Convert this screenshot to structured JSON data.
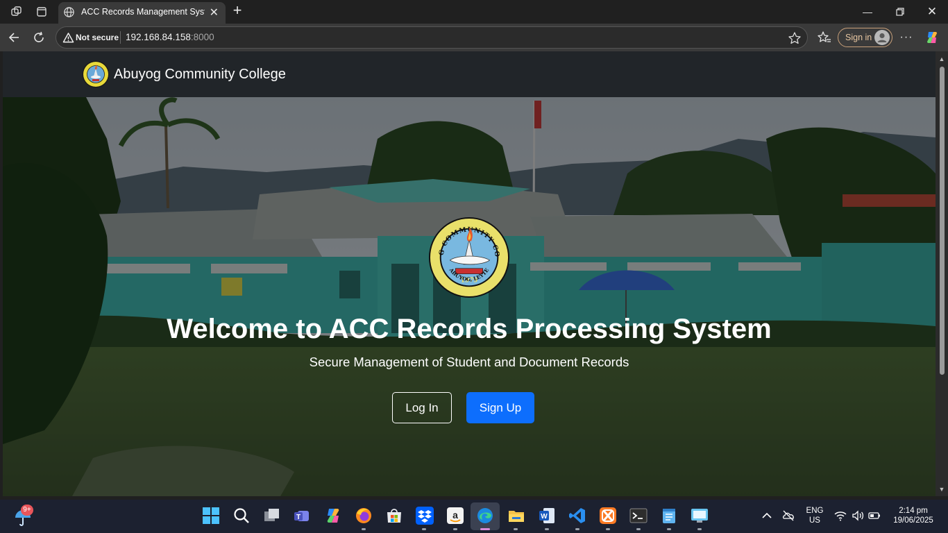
{
  "browser": {
    "tab_title": "ACC Records Management System",
    "address_security": "Not secure",
    "address_host": "192.168.84.158",
    "address_port": ":8000",
    "signin_label": "Sign in"
  },
  "site": {
    "brand_name": "Abuyog Community College",
    "hero_title": "Welcome to ACC Records Processing System",
    "hero_subtitle": "Secure Management of Student and Document Records",
    "login_label": "Log In",
    "signup_label": "Sign Up",
    "seal_text_top": "ABUYOG COMMUNITY COLLEGE",
    "seal_text_bottom": "ABUYOG, LEYTE",
    "seal_year": "1979"
  },
  "colors": {
    "navbar": "#212529",
    "primary_button": "#0d6efd",
    "browser_toolbar": "#3a3a3a",
    "taskbar": "#1c2130"
  },
  "taskbar": {
    "notification_badge": "9+",
    "language": "ENG",
    "region": "US",
    "time": "2:14 pm",
    "date": "19/06/2025",
    "apps": [
      "windows-start-icon",
      "search-icon",
      "task-view-icon",
      "teams-icon",
      "copilot-icon",
      "firefox-icon",
      "microsoft-store-icon",
      "dropbox-icon",
      "amazon-icon",
      "edge-icon",
      "file-explorer-icon",
      "word-icon",
      "vscode-icon",
      "xampp-icon",
      "terminal-icon",
      "notepad-icon",
      "remote-desktop-icon"
    ]
  }
}
